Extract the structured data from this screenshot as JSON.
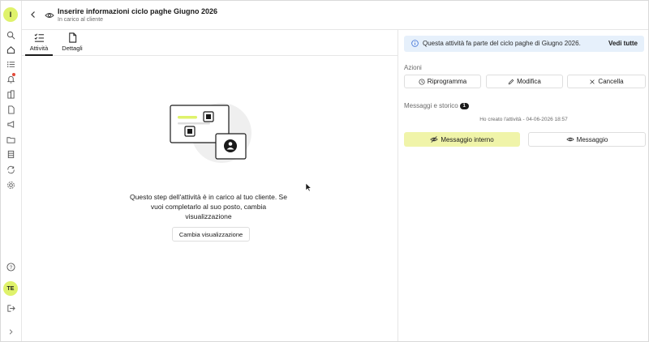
{
  "rail": {
    "logo_letter": "I",
    "user_initials": "TE",
    "icons": [
      "search-icon",
      "home-icon",
      "tasks-icon",
      "bell-icon",
      "building-icon",
      "document-icon",
      "megaphone-icon",
      "folder-icon",
      "archive-icon",
      "sync-icon",
      "settings-icon",
      "help-icon",
      "logout-icon",
      "expand-icon"
    ]
  },
  "header": {
    "title": "Inserire informazioni ciclo paghe Giugno 2026",
    "subtitle": "In carico al cliente"
  },
  "tabs": [
    {
      "label": "Attività",
      "icon": "checklist-icon",
      "active": true
    },
    {
      "label": "Dettagli",
      "icon": "document-icon",
      "active": false
    }
  ],
  "empty_state": {
    "message": "Questo step dell'attività è in carico al tuo cliente. Se vuoi completarlo al suo posto, cambia visualizzazione",
    "button_label": "Cambia visualizzazione"
  },
  "info_banner": {
    "text": "Questa attività fa parte del ciclo paghe di Giugno 2026.",
    "link": "Vedi tutte"
  },
  "actions": {
    "label": "Azioni",
    "reschedule": "Riprogramma",
    "edit": "Modifica",
    "cancel": "Cancella"
  },
  "messages": {
    "label": "Messaggi e storico",
    "count": "1",
    "history_entry": "Ho creato l'attività - 04-06-2026 18:57",
    "internal_button": "Messaggio interno",
    "message_button": "Messaggio"
  },
  "colors": {
    "accent": "#dff26b",
    "internal_message_bg": "#f0f4a9",
    "info_bg": "#e6f0fb",
    "notification_dot": "#e34b3b"
  }
}
